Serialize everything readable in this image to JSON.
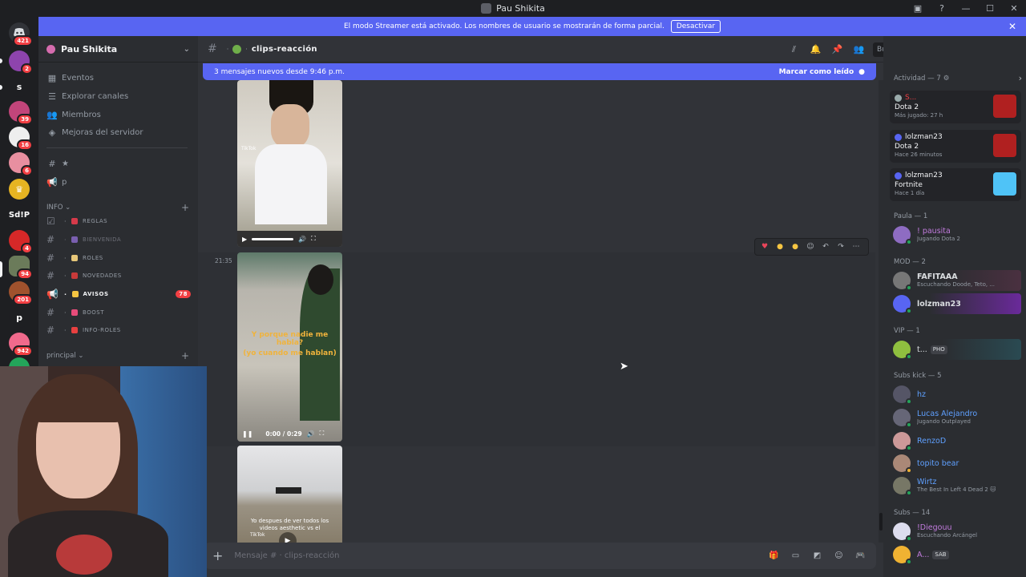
{
  "window": {
    "title": "Pau Shikita"
  },
  "rail": {
    "servers": [
      {
        "label": "",
        "badge": "421"
      },
      {
        "label": "",
        "badge": "2"
      },
      {
        "label": "s",
        "badge": ""
      },
      {
        "label": "",
        "badge": "39"
      },
      {
        "label": "",
        "badge": "16"
      },
      {
        "label": "",
        "badge": "6"
      },
      {
        "label": "",
        "badge": ""
      },
      {
        "label": "Sd!P",
        "badge": ""
      },
      {
        "label": "",
        "badge": "4"
      },
      {
        "label": "",
        "badge": "94"
      },
      {
        "label": "",
        "badge": "201"
      },
      {
        "label": "p",
        "badge": ""
      },
      {
        "label": "",
        "badge": "942"
      }
    ]
  },
  "banner": {
    "text": "El modo Streamer está activado. Los nombres de usuario se mostrarán de forma parcial.",
    "button": "Desactivar"
  },
  "guild": {
    "name": "Pau Shikita"
  },
  "sidebar": {
    "top_items": [
      "Eventos",
      "Explorar canales",
      "Miembros",
      "Mejoras del servidor"
    ],
    "loose_channels": [
      "★",
      "p"
    ],
    "category_info": "INFO",
    "channels": [
      {
        "name": "REGLAS",
        "badge": ""
      },
      {
        "name": "BIENVENIDA",
        "badge": ""
      },
      {
        "name": "ROLES",
        "badge": ""
      },
      {
        "name": "NOVEDADES",
        "badge": ""
      },
      {
        "name": "AVISOS",
        "badge": "78"
      },
      {
        "name": "BOOST",
        "badge": ""
      },
      {
        "name": "INFO-ROLES",
        "badge": ""
      }
    ],
    "category_principal": "principal"
  },
  "channel": {
    "name": "clips-reacción"
  },
  "search": {
    "placeholder": "Buscar"
  },
  "new_messages": {
    "text": "3 mensajes nuevos desde 9:46 p.m.",
    "mark_read": "Marcar como leído"
  },
  "messages": {
    "timestamp": "21:35",
    "video1_watermark": "TikTok",
    "video2_caption1": "Y porque nadie me habla?",
    "video2_caption2": "(yo cuando me hablan)",
    "video2_time": "0:00 / 0:29",
    "video3_caption": "Yo despues de ver todos los videos aesthetic vs el",
    "video3_watermark": "TikTok"
  },
  "composer": {
    "placeholder": "Mensaje # · clips-reacción"
  },
  "members": {
    "activity_title": "Actividad — 7",
    "activities": [
      {
        "user": "S...",
        "game": "Dota 2",
        "detail": "Más jugado: 27 h"
      },
      {
        "user": "lolzman23",
        "game": "Dota 2",
        "detail": "Hace 26 minutos"
      },
      {
        "user": "lolzman23",
        "game": "Fortnite",
        "detail": "Hace 1 día"
      }
    ],
    "groups": [
      {
        "title": "Paula — 1",
        "members": [
          {
            "name": "! pausita",
            "status": "Jugando Dota 2",
            "color": "#c27cde"
          }
        ]
      },
      {
        "title": "MOD — 2",
        "members": [
          {
            "name": "FAFITAAA",
            "status": "Escuchando Doode, Teto, ...",
            "color": "#f2f3f5"
          },
          {
            "name": "lolzman23",
            "status": "",
            "color": "#f2f3f5"
          }
        ]
      },
      {
        "title": "VIP — 1",
        "members": [
          {
            "name": "t...",
            "status": "",
            "color": "#f2f3f5",
            "tag": "PHO"
          }
        ]
      },
      {
        "title": "Subs kick — 5",
        "members": [
          {
            "name": "hz",
            "status": "",
            "color": "#5fa0ff"
          },
          {
            "name": "Lucas Alejandro",
            "status": "Jugando Outplayed",
            "color": "#5fa0ff"
          },
          {
            "name": "RenzoD",
            "status": "",
            "color": "#5fa0ff"
          },
          {
            "name": "topito bear",
            "status": "",
            "color": "#5fa0ff"
          },
          {
            "name": "Wirtz",
            "status": "The Best In Left 4 Dead 2 🐱",
            "color": "#5fa0ff"
          }
        ]
      },
      {
        "title": "Subs — 14",
        "members": [
          {
            "name": "!Diegouu",
            "status": "Escuchando Arcángel",
            "color": "#c27cde"
          },
          {
            "name": "A...",
            "status": "",
            "color": "#c27cde",
            "tag": "SAB"
          }
        ]
      }
    ]
  }
}
